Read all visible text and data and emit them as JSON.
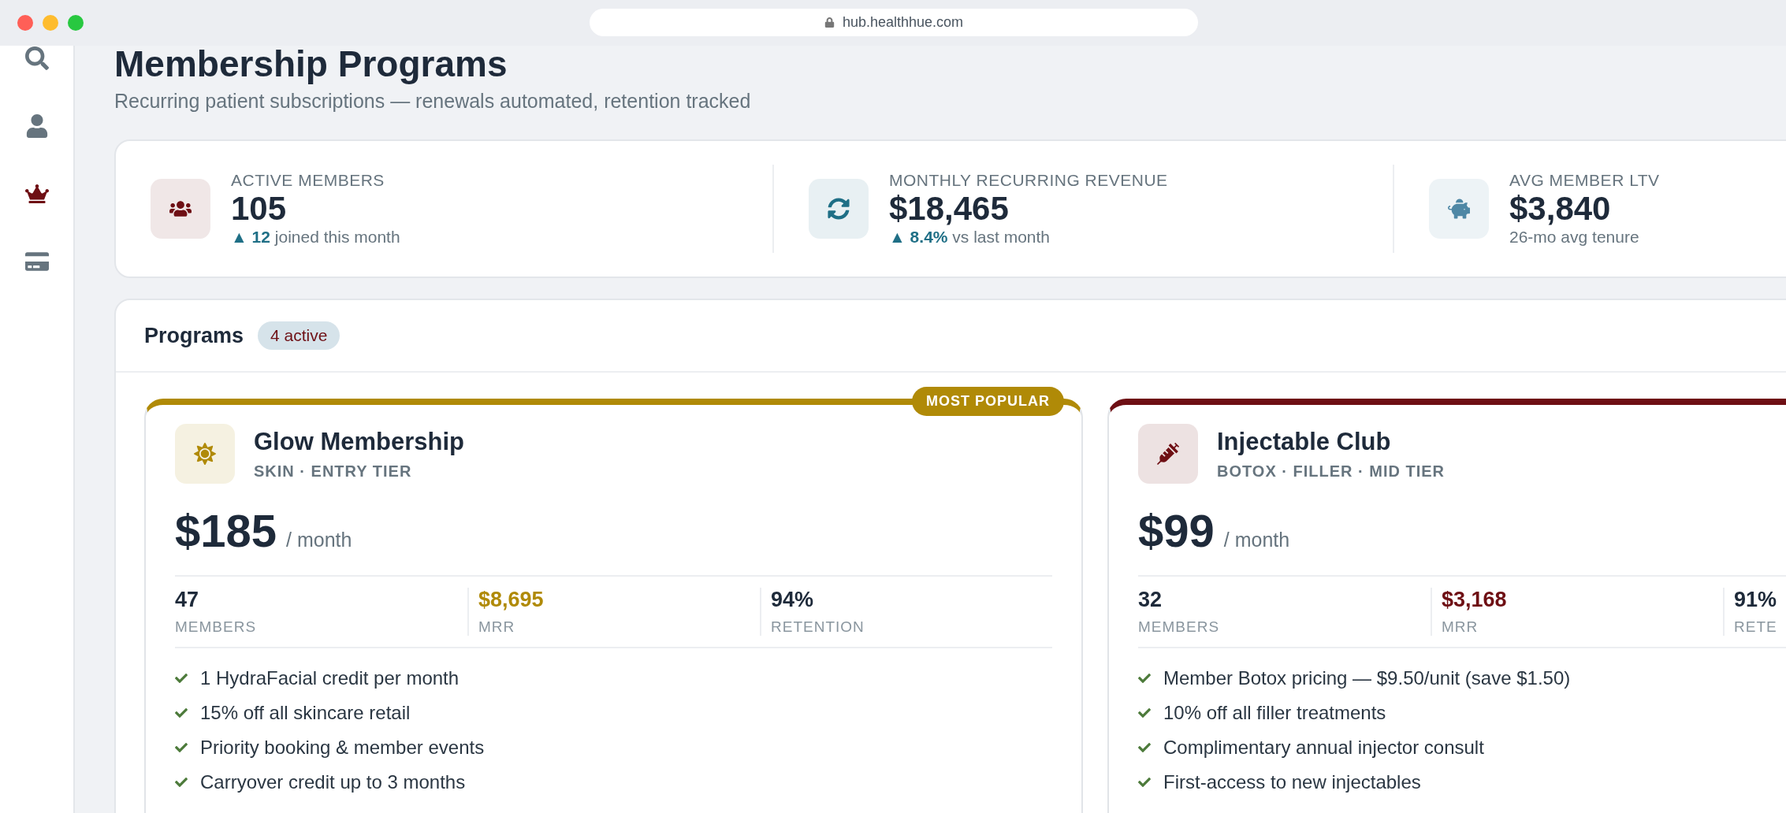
{
  "browser": {
    "url": "hub.healthhue.com"
  },
  "sidebar": {
    "items": [
      {
        "kind": "search",
        "selected": false
      },
      {
        "kind": "user",
        "selected": false
      },
      {
        "kind": "crown",
        "selected": true
      },
      {
        "kind": "card",
        "selected": false
      }
    ]
  },
  "page": {
    "title": "Membership Programs",
    "subtitle": "Recurring patient subscriptions — renewals automated, retention tracked"
  },
  "stats": [
    {
      "kind": "users",
      "color": "#6e0f14",
      "label": "ACTIVE MEMBERS",
      "value": "105",
      "change": "▲ 12",
      "note": "joined this month"
    },
    {
      "kind": "sync",
      "color": "#1f6f86",
      "label": "MONTHLY RECURRING REVENUE",
      "value": "$18,465",
      "change": "▲ 8.4%",
      "note": "vs last month"
    },
    {
      "kind": "piggy",
      "color": "#4e87a5",
      "label": "AVG MEMBER LTV",
      "value": "$3,840",
      "note": "26-mo avg tenure"
    }
  ],
  "programs": {
    "title": "Programs",
    "badge": "4 active",
    "cards": [
      {
        "kind": "sun",
        "color": "#b08a07",
        "badge": "MOST POPULAR",
        "name": "Glow Membership",
        "subtitle": "SKIN · ENTRY TIER",
        "price": "$185",
        "period": "/ month",
        "stats": [
          {
            "value": "47",
            "label": "MEMBERS",
            "accent": false
          },
          {
            "value": "$8,695",
            "label": "MRR",
            "accent": true
          },
          {
            "value": "94%",
            "label": "RETENTION",
            "accent": false
          }
        ],
        "features": [
          "1 HydraFacial credit per month",
          "15% off all skincare retail",
          "Priority booking & member events",
          "Carryover credit up to 3 months"
        ]
      },
      {
        "kind": "syringe",
        "color": "#6e0f14",
        "name": "Injectable Club",
        "subtitle": "BOTOX · FILLER · MID TIER",
        "price": "$99",
        "period": "/ month",
        "stats": [
          {
            "value": "32",
            "label": "MEMBERS",
            "accent": false
          },
          {
            "value": "$3,168",
            "label": "MRR",
            "accent": true
          },
          {
            "value": "91%",
            "label": "RETE",
            "accent": false
          }
        ],
        "features": [
          "Member Botox pricing — $9.50/unit (save $1.50)",
          "10% off all filler treatments",
          "Complimentary annual injector consult",
          "First-access to new injectables"
        ]
      }
    ]
  }
}
